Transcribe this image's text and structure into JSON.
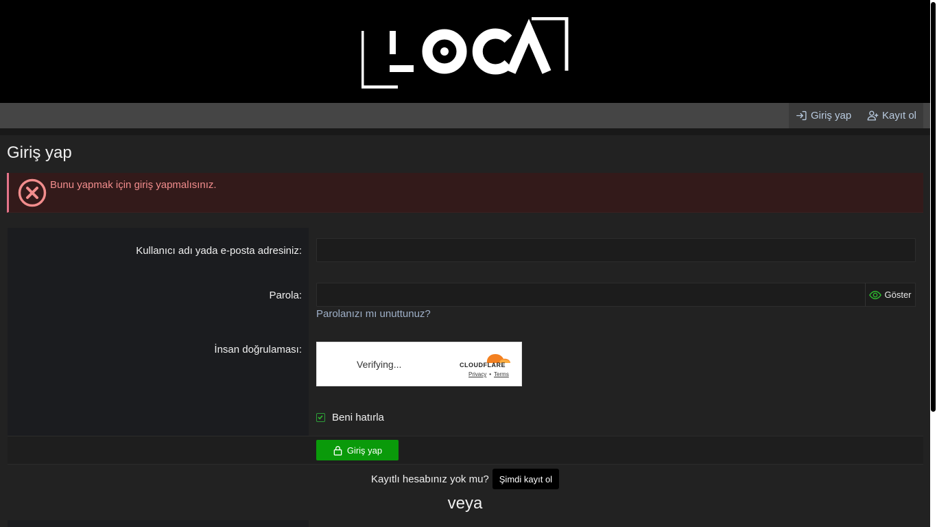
{
  "header": {
    "logo_text": "LOCA"
  },
  "nav": {
    "login_label": "Giriş yap",
    "register_label": "Kayıt ol"
  },
  "page": {
    "title": "Giriş yap"
  },
  "alert": {
    "message": "Bunu yapmak için giriş yapmalısınız."
  },
  "form": {
    "username_label": "Kullanıcı adı yada e-posta adresiniz:",
    "username_value": "",
    "password_label": "Parola:",
    "password_value": "",
    "show_label": "Göster",
    "forgot_label": "Parolanızı mı unuttunuz?",
    "human_label": "İnsan doğrulaması:",
    "captcha": {
      "status": "Verifying...",
      "brand": "CLOUDFLARE",
      "privacy": "Privacy",
      "separator": "•",
      "terms": "Terms"
    },
    "remember_label": "Beni hatırla",
    "remember_checked": true,
    "submit_label": "Giriş yap"
  },
  "register": {
    "question": "Kayıtlı hesabınız yok mu?",
    "button_label": "Şimdi kayıt ol"
  },
  "or_text": "veya",
  "colors": {
    "accent_green": "#0a9a0a",
    "link_blue": "#9fb0c8",
    "alert_red": "#f28d8d",
    "cloudflare_orange": "#f38020"
  }
}
